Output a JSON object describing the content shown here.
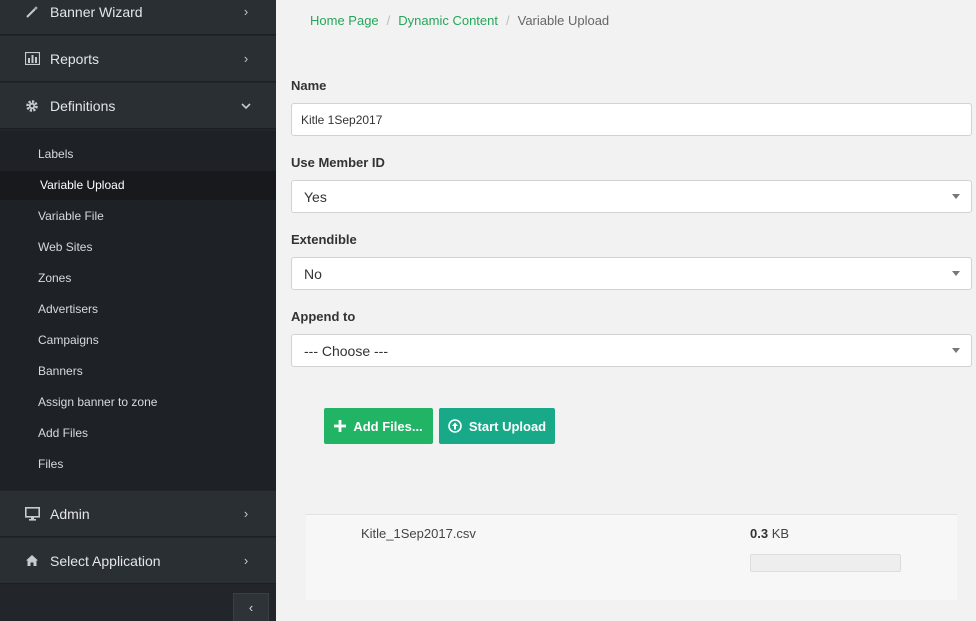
{
  "sidebar": {
    "top_items": [
      {
        "label": "Banner Wizard",
        "icon": "magic-wand-icon"
      },
      {
        "label": "Reports",
        "icon": "bar-chart-icon"
      },
      {
        "label": "Definitions",
        "icon": "gear-icon"
      }
    ],
    "sub_items": [
      {
        "label": "Labels"
      },
      {
        "label": "Variable Upload",
        "active": true
      },
      {
        "label": "Variable File"
      },
      {
        "label": "Web Sites"
      },
      {
        "label": "Zones"
      },
      {
        "label": "Advertisers"
      },
      {
        "label": "Campaigns"
      },
      {
        "label": "Banners"
      },
      {
        "label": "Assign banner to zone"
      },
      {
        "label": "Add Files"
      },
      {
        "label": "Files"
      }
    ],
    "bottom_items": [
      {
        "label": "Admin",
        "icon": "monitor-icon"
      },
      {
        "label": "Select Application",
        "icon": "home-icon"
      }
    ],
    "collapse_glyph": "‹"
  },
  "breadcrumb": {
    "items": [
      "Home Page",
      "Dynamic Content",
      "Variable Upload"
    ],
    "separator": "/"
  },
  "form": {
    "name_label": "Name",
    "name_value": "Kitle 1Sep2017",
    "member_label": "Use Member ID",
    "member_value": "Yes",
    "extendible_label": "Extendible",
    "extendible_value": "No",
    "append_label": "Append to",
    "append_value": "--- Choose ---"
  },
  "actions": {
    "add_label": "Add Files...",
    "start_label": "Start Upload"
  },
  "upload": {
    "file_name": "Kitle_1Sep2017.csv",
    "size_value": "0.3",
    "size_unit": "KB",
    "progress": 0
  },
  "colors": {
    "accent_green": "#20b464",
    "accent_teal": "#17a988",
    "sidebar_bg": "#22262b"
  }
}
